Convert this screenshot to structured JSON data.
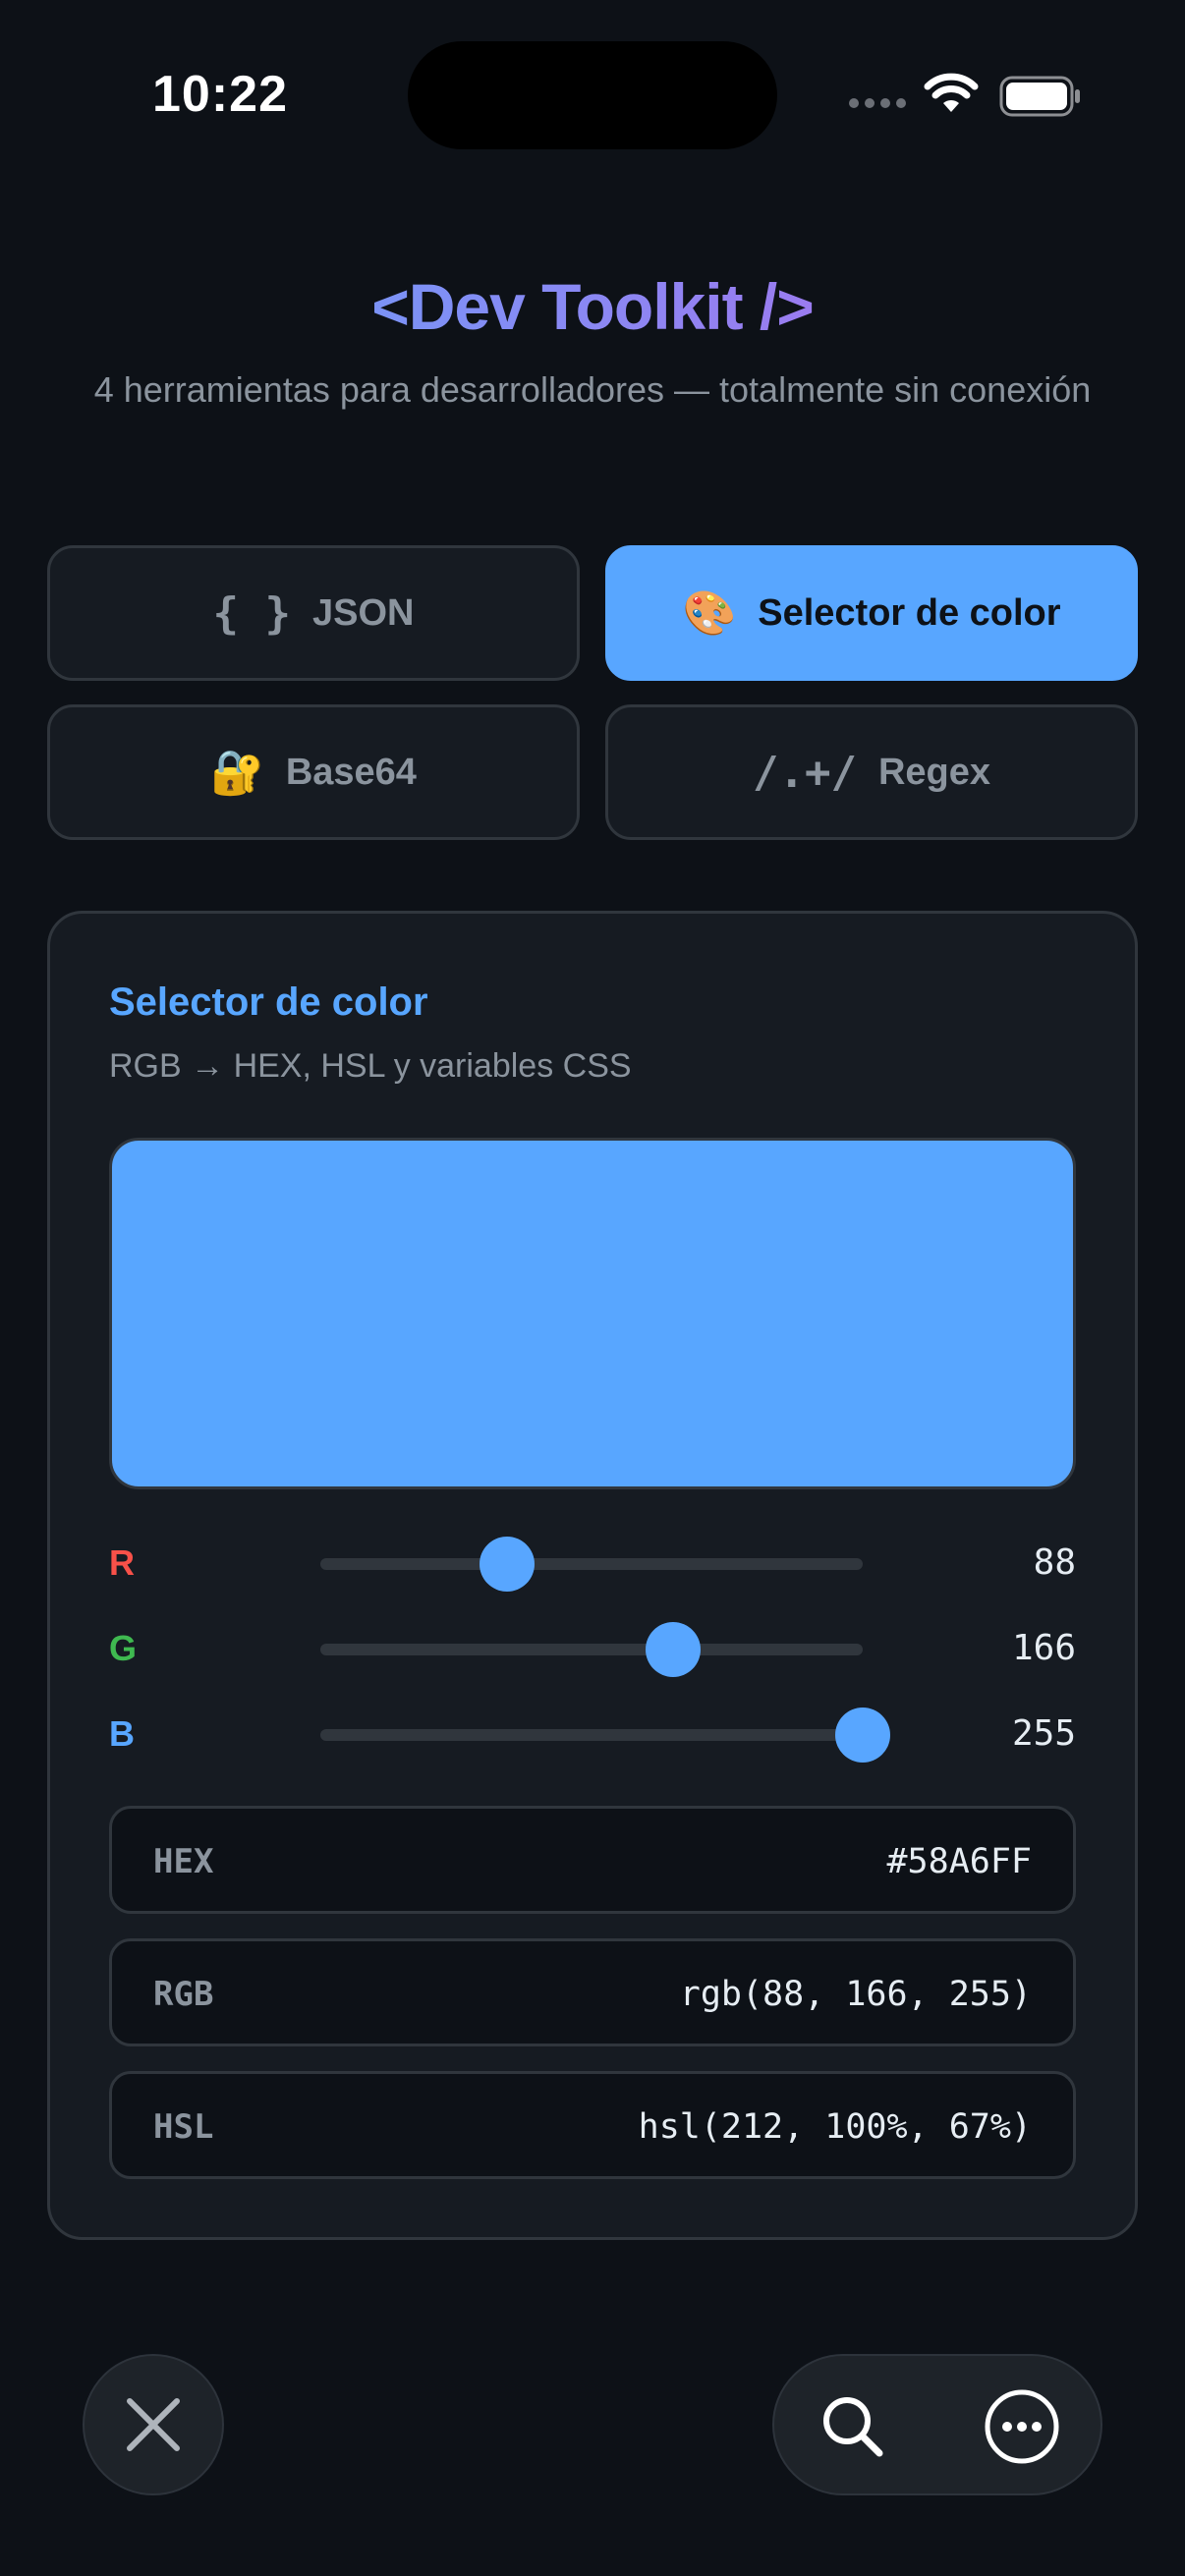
{
  "status_bar": {
    "time": "10:22"
  },
  "header": {
    "title": "<Dev Toolkit />",
    "subtitle": "4 herramientas para desarrolladores — totalmente sin conexión"
  },
  "tabs": [
    {
      "icon": "{ }",
      "label": "JSON",
      "active": false
    },
    {
      "icon": "🎨",
      "label": "Selector de color",
      "active": true
    },
    {
      "icon": "🔐",
      "label": "Base64",
      "active": false
    },
    {
      "icon": "/.+/",
      "label": "Regex",
      "active": false
    }
  ],
  "color_picker": {
    "title": "Selector de color",
    "description": "RGB → HEX, HSL y variables CSS",
    "preview_color": "#58A6FF",
    "sliders": [
      {
        "label": "R",
        "value": 88,
        "max": 255,
        "label_color": "#f85149"
      },
      {
        "label": "G",
        "value": 166,
        "max": 255,
        "label_color": "#3fb950"
      },
      {
        "label": "B",
        "value": 255,
        "max": 255,
        "label_color": "#58a6ff"
      }
    ],
    "outputs": [
      {
        "label": "HEX",
        "value": "#58A6FF"
      },
      {
        "label": "RGB",
        "value": "rgb(88, 166, 255)"
      },
      {
        "label": "HSL",
        "value": "hsl(212, 100%, 67%)"
      }
    ]
  },
  "colors": {
    "accent": "#58a6ff",
    "background": "#0d1117",
    "card": "#161b22",
    "title_gradient_start": "#7b93f6",
    "title_gradient_end": "#9a7cf0"
  },
  "icons": {
    "close": "close-icon",
    "search": "search-icon",
    "more": "more-icon",
    "wifi": "wifi-icon",
    "battery": "battery-icon"
  }
}
